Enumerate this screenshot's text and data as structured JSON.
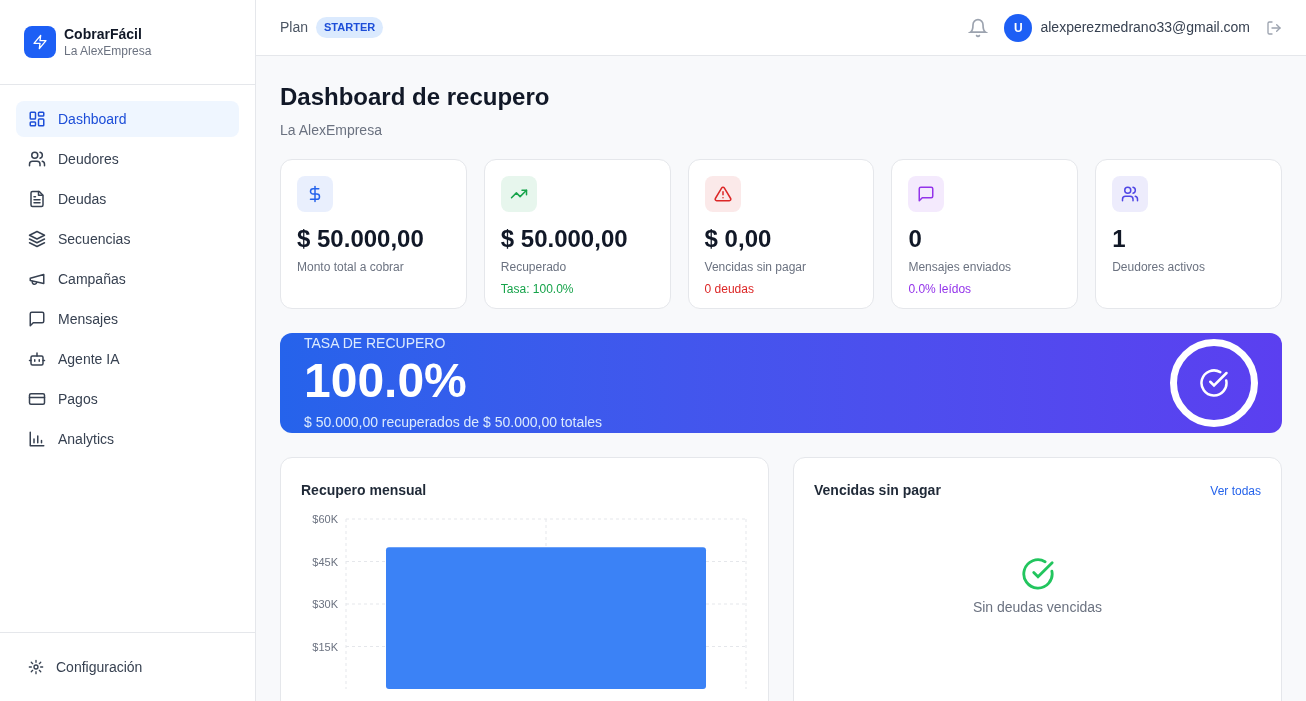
{
  "brand": {
    "name": "CobrarFácil",
    "company": "La AlexEmpresa"
  },
  "nav": [
    {
      "label": "Dashboard",
      "selected": true
    },
    {
      "label": "Deudores",
      "selected": false
    },
    {
      "label": "Deudas",
      "selected": false
    },
    {
      "label": "Secuencias",
      "selected": false
    },
    {
      "label": "Campañas",
      "selected": false
    },
    {
      "label": "Mensajes",
      "selected": false
    },
    {
      "label": "Agente IA",
      "selected": false
    },
    {
      "label": "Pagos",
      "selected": false
    },
    {
      "label": "Analytics",
      "selected": false
    }
  ],
  "settings": {
    "label": "Configuración"
  },
  "header": {
    "plan_label": "Plan",
    "plan": "STARTER",
    "avatar": "U",
    "email": "alexperezmedrano33@gmail.com"
  },
  "page": {
    "title": "Dashboard de recupero",
    "subtitle": "La AlexEmpresa"
  },
  "stats": [
    {
      "value": "$ 50.000,00",
      "label": "Monto total a cobrar",
      "color": "#2563eb"
    },
    {
      "value": "$ 50.000,00",
      "label": "Recuperado",
      "note": "Tasa: 100.0%",
      "color": "#16a34a"
    },
    {
      "value": "$ 0,00",
      "label": "Vencidas sin pagar",
      "note": "0 deudas",
      "color": "#dc2626"
    },
    {
      "value": "0",
      "label": "Mensajes enviados",
      "note": "0.0% leídos",
      "color": "#9333ea"
    },
    {
      "value": "1",
      "label": "Deudores activos",
      "color": "#4f46e5"
    }
  ],
  "banner": {
    "label": "TASA DE RECUPERO",
    "value": "100.0%",
    "description": "$ 50.000,00 recuperados de $ 50.000,00 totales"
  },
  "monthly": {
    "title": "Recupero mensual",
    "chart_data": {
      "type": "bar",
      "grid": true,
      "values": [
        50000
      ],
      "ylim": [
        0,
        60000
      ],
      "yticks": [
        {
          "value": 15000,
          "label": "$15K"
        },
        {
          "value": 30000,
          "label": "$30K"
        },
        {
          "value": 45000,
          "label": "$45K"
        },
        {
          "value": 60000,
          "label": "$60K"
        }
      ]
    }
  },
  "overdue": {
    "title": "Vencidas sin pagar",
    "link": "Ver todas",
    "empty": "Sin deudas vencidas"
  }
}
